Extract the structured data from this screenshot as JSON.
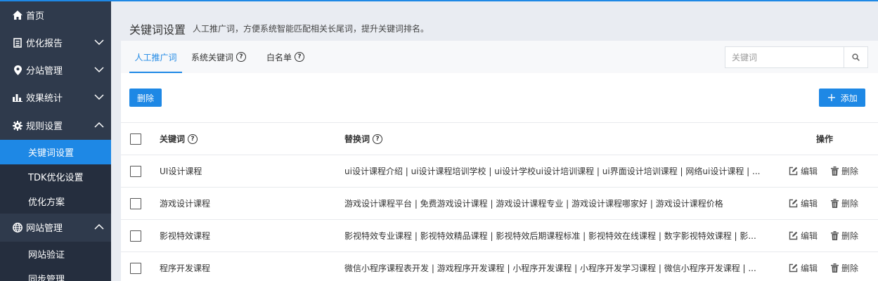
{
  "sidebar": {
    "items": [
      {
        "label": "首页"
      },
      {
        "label": "优化报告"
      },
      {
        "label": "分站管理"
      },
      {
        "label": "效果统计"
      },
      {
        "label": "规则设置"
      },
      {
        "label": "网站管理"
      }
    ],
    "subitems_rules": [
      {
        "label": "关键词设置"
      },
      {
        "label": "TDK优化设置"
      },
      {
        "label": "优化方案"
      }
    ],
    "subitems_site": [
      {
        "label": "网站验证"
      },
      {
        "label": "同步管理"
      }
    ]
  },
  "header": {
    "title": "关键词设置",
    "desc": "人工推广词，方便系统智能匹配相关长尾词，提升关键词排名。"
  },
  "tabs": [
    {
      "label": "人工推广词"
    },
    {
      "label": "系统关键词"
    },
    {
      "label": "白名单"
    }
  ],
  "search": {
    "placeholder": "关键词"
  },
  "buttons": {
    "delete": "删除",
    "add": "添加"
  },
  "table": {
    "headers": {
      "keyword": "关键词",
      "replace": "替换词",
      "ops": "操作"
    },
    "actions": {
      "edit": "编辑",
      "delete": "删除"
    },
    "rows": [
      {
        "keyword": "UI设计课程",
        "replace": "ui设计课程介绍 | ui设计课程培训学校 | ui设计学校ui设计培训课程 | ui界面设计培训课程 | 网络ui设计课程 | ..."
      },
      {
        "keyword": "游戏设计课程",
        "replace": "游戏设计课程平台 | 免费游戏设计课程 | 游戏设计课程专业 | 游戏设计课程哪家好 | 游戏设计课程价格"
      },
      {
        "keyword": "影视特效课程",
        "replace": "影视特效专业课程 | 影视特效精品课程 | 影视特效后期课程标准 | 影视特效在线课程 | 数字影视特效课程 | 影..."
      },
      {
        "keyword": "程序开发课程",
        "replace": "微信小程序课程表开发 | 游戏程序开发课程 | 小程序开发课程 | 小程序开发学习课程 | 微信小程序开发课程 | ..."
      }
    ]
  },
  "colors": {
    "accent": "#1e88e5",
    "sidebar": "#2f3a4c",
    "submenu": "#252e3e"
  }
}
